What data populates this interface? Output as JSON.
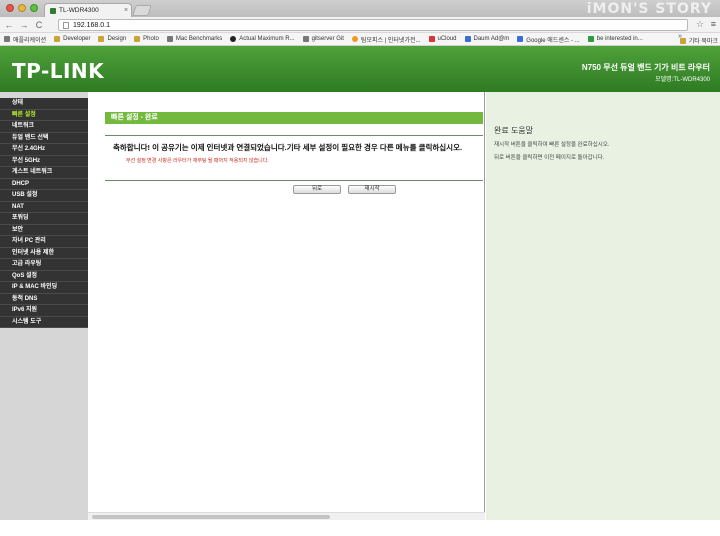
{
  "browser": {
    "tab_title": "TL-WDR4300",
    "tab_close": "×",
    "watermark": "iMON'S STORY",
    "url": "192.168.0.1",
    "back": "←",
    "forward": "→",
    "reload": "C",
    "star": "☆",
    "menu": "≡",
    "bookmarks": [
      {
        "label": "애플리케이션",
        "icon": "apps-icon"
      },
      {
        "label": "Developer",
        "icon": "folder-icon"
      },
      {
        "label": "Design",
        "icon": "folder-icon"
      },
      {
        "label": "Photo",
        "icon": "folder-icon"
      },
      {
        "label": "Mac Benchmarks",
        "icon": "gear-icon"
      },
      {
        "label": "Actual Maximum R...",
        "icon": "circle-icon"
      },
      {
        "label": "gitserver Git",
        "icon": "grid-icon"
      },
      {
        "label": "팀모피스 | 인터넷가전...",
        "icon": "badge-icon"
      },
      {
        "label": "uCloud",
        "icon": "cloud-icon"
      },
      {
        "label": "Daum Ad@m",
        "icon": "daum-icon"
      },
      {
        "label": "Google 애드센스 - ...",
        "icon": "google-icon"
      },
      {
        "label": "be interested in...",
        "icon": "im-icon"
      }
    ],
    "bookmarks_more": "»",
    "bookmarks_other": "기타 북마크"
  },
  "header": {
    "logo": "TP-LINK",
    "product": "N750 무선 듀얼 밴드 기가 비트 라우터",
    "model": "모델명:TL-WDR4300"
  },
  "sidebar": {
    "items": [
      {
        "label": "상태",
        "active": false
      },
      {
        "label": "빠른 설정",
        "active": true
      },
      {
        "label": "네트워크",
        "active": false
      },
      {
        "label": "듀얼 밴드 선택",
        "active": false
      },
      {
        "label": "무선 2.4GHz",
        "active": false
      },
      {
        "label": "무선 5GHz",
        "active": false
      },
      {
        "label": "게스트 네트워크",
        "active": false
      },
      {
        "label": "DHCP",
        "active": false
      },
      {
        "label": "USB 설정",
        "active": false
      },
      {
        "label": "NAT",
        "active": false
      },
      {
        "label": "포워딩",
        "active": false
      },
      {
        "label": "보안",
        "active": false
      },
      {
        "label": "자녀 PC 관리",
        "active": false
      },
      {
        "label": "인터넷 사용 제한",
        "active": false
      },
      {
        "label": "고급 라우팅",
        "active": false
      },
      {
        "label": "QoS 설정",
        "active": false
      },
      {
        "label": "IP & MAC 바인딩",
        "active": false
      },
      {
        "label": "동적 DNS",
        "active": false
      },
      {
        "label": "IPv6 지원",
        "active": false
      },
      {
        "label": "시스템 도구",
        "active": false
      }
    ]
  },
  "main": {
    "title": "빠른 설정 - 완료",
    "congrats": "축하합니다! 이 공유기는 이제 인터넷과 연결되었습니다.기타 세부 설정이 필요한 경우 다른 메뉴를 클릭하십시오.",
    "notice": "무선 설정 변경 사항은 라우터가 재부팅 될 때까지 적용되지 않습니다.",
    "back_button": "뒤로",
    "restart_button": "재시작"
  },
  "help": {
    "title": "완료 도움말",
    "line1": "재시작 버튼을 클릭하여 빠른 설정을 완료하십시오.",
    "line2": "뒤로 버튼을 클릭하면 이전 페이지로 돌아갑니다."
  },
  "colors": {
    "header_green": "#3f9230",
    "title_bar_green": "#74b93f",
    "sidebar_dark": "#333333",
    "sidebar_active": "#b8ee2e",
    "help_bg": "#e8f1e2",
    "notice_red": "#cc2a1f"
  }
}
